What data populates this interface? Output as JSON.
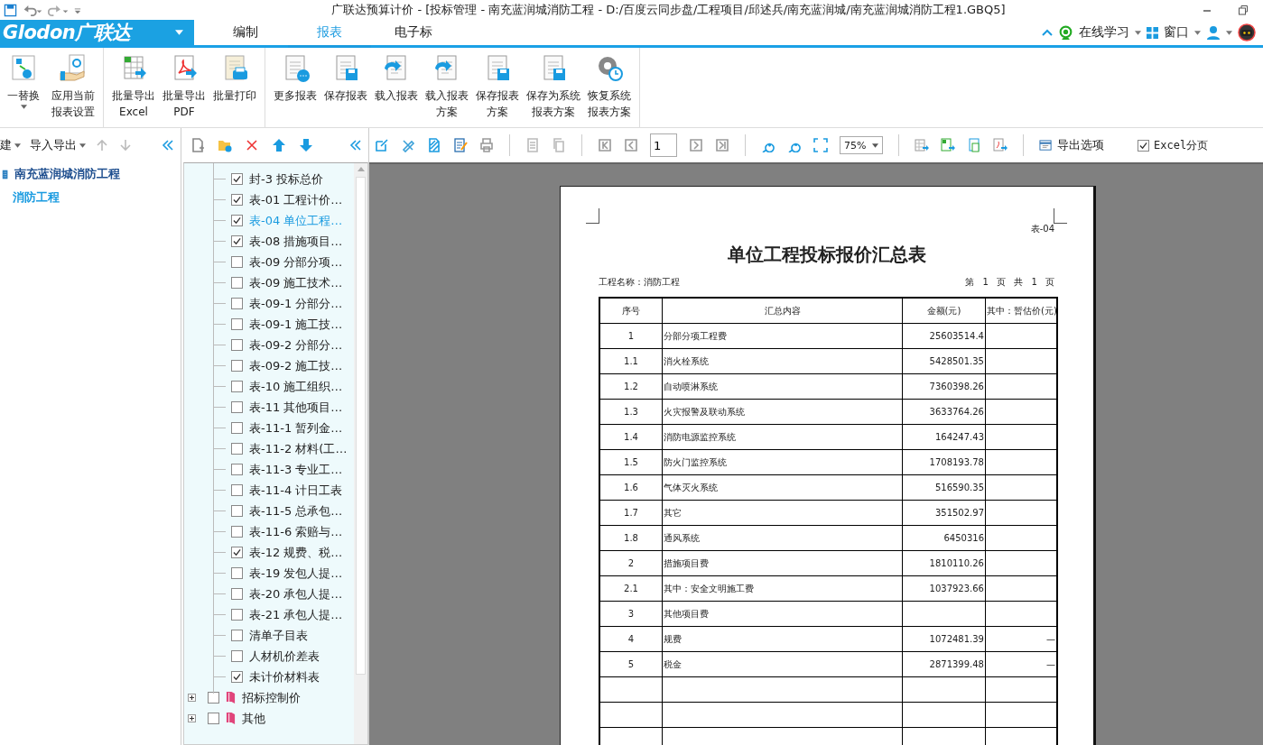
{
  "window": {
    "title": "广联达预算计价 - [投标管理 - 南充蓝润城消防工程 - D:/百度云同步盘/工程项目/邱述兵/南充蓝润城/南充蓝润城消防工程1.GBQ5]"
  },
  "logo": "Glodon广联达",
  "tabs": [
    {
      "label": "编制",
      "selected": false
    },
    {
      "label": "报表",
      "selected": true
    },
    {
      "label": "电子标",
      "selected": false
    }
  ],
  "top_right": [
    {
      "label": "在线学习"
    },
    {
      "label": "窗口"
    }
  ],
  "ribbon": [
    [
      {
        "lines": [
          "一替换"
        ],
        "dropdown": true
      },
      {
        "lines": [
          "应用当前",
          "报表设置"
        ],
        "dropdown": false
      }
    ],
    [
      {
        "lines": [
          "批量导出",
          "Excel"
        ],
        "dropdown": false
      },
      {
        "lines": [
          "批量导出",
          "PDF"
        ],
        "dropdown": false
      },
      {
        "lines": [
          "批量打印"
        ],
        "dropdown": false
      }
    ],
    [
      {
        "lines": [
          "更多报表"
        ],
        "dropdown": false
      },
      {
        "lines": [
          "保存报表"
        ],
        "dropdown": false
      },
      {
        "lines": [
          "载入报表"
        ],
        "dropdown": false
      },
      {
        "lines": [
          "载入报表",
          "方案"
        ],
        "dropdown": false
      },
      {
        "lines": [
          "保存报表",
          "方案"
        ],
        "dropdown": false
      },
      {
        "lines": [
          "保存为系统",
          "报表方案"
        ],
        "dropdown": false
      },
      {
        "lines": [
          "恢复系统",
          "报表方案"
        ],
        "dropdown": false
      }
    ]
  ],
  "left_panel": {
    "toolbar": [
      {
        "label": "建"
      },
      {
        "label": "导入导出"
      }
    ],
    "tree": [
      {
        "label": "南充蓝润城消防工程",
        "selected": false,
        "children": [
          {
            "label": "消防工程",
            "selected": true
          }
        ]
      }
    ]
  },
  "report_list": {
    "items": [
      {
        "label": "封-3 投标总价",
        "checked": true,
        "selected": false
      },
      {
        "label": "表-01 工程计价…",
        "checked": true,
        "selected": false
      },
      {
        "label": "表-04 单位工程…",
        "checked": true,
        "selected": true
      },
      {
        "label": "表-08 措施项目…",
        "checked": true,
        "selected": false
      },
      {
        "label": "表-09 分部分项…",
        "checked": false,
        "selected": false
      },
      {
        "label": "表-09 施工技术…",
        "checked": false,
        "selected": false
      },
      {
        "label": "表-09-1 分部分…",
        "checked": false,
        "selected": false
      },
      {
        "label": "表-09-1 施工技…",
        "checked": false,
        "selected": false
      },
      {
        "label": "表-09-2 分部分…",
        "checked": false,
        "selected": false
      },
      {
        "label": "表-09-2 施工技…",
        "checked": false,
        "selected": false
      },
      {
        "label": "表-10 施工组织…",
        "checked": false,
        "selected": false
      },
      {
        "label": "表-11 其他项目…",
        "checked": false,
        "selected": false
      },
      {
        "label": "表-11-1 暂列金…",
        "checked": false,
        "selected": false
      },
      {
        "label": "表-11-2 材料(工…",
        "checked": false,
        "selected": false
      },
      {
        "label": "表-11-3 专业工…",
        "checked": false,
        "selected": false
      },
      {
        "label": "表-11-4 计日工表",
        "checked": false,
        "selected": false
      },
      {
        "label": "表-11-5 总承包…",
        "checked": false,
        "selected": false
      },
      {
        "label": "表-11-6 索赔与…",
        "checked": false,
        "selected": false
      },
      {
        "label": "表-12 规费、税…",
        "checked": true,
        "selected": false
      },
      {
        "label": "表-19 发包人提…",
        "checked": false,
        "selected": false
      },
      {
        "label": "表-20 承包人提…",
        "checked": false,
        "selected": false
      },
      {
        "label": "表-21 承包人提…",
        "checked": false,
        "selected": false
      },
      {
        "label": "清单子目表",
        "checked": false,
        "selected": false
      },
      {
        "label": "人材机价差表",
        "checked": false,
        "selected": false
      },
      {
        "label": "未计价材料表",
        "checked": true,
        "selected": false
      }
    ],
    "groups": [
      {
        "label": "招标控制价",
        "checked": false,
        "expanded": false
      },
      {
        "label": "其他",
        "checked": false,
        "expanded": false
      }
    ]
  },
  "viewer_toolbar": {
    "page": "1",
    "zoom": "75%",
    "export_options": "导出选项",
    "excel_paging": {
      "label": "Excel分页",
      "checked": true
    }
  },
  "report": {
    "code": "表-04",
    "title": "单位工程投标报价汇总表",
    "project": "工程名称：消防工程",
    "page_info": "第 1 页 共 1 页",
    "columns": [
      "序号",
      "汇总内容",
      "金额(元)",
      "其中：暂估价(元)"
    ],
    "rows": [
      [
        "1",
        "分部分项工程费",
        "25603514.4",
        null
      ],
      [
        "1.1",
        "消火栓系统",
        "5428501.35",
        null
      ],
      [
        "1.2",
        "自动喷淋系统",
        "7360398.26",
        null
      ],
      [
        "1.3",
        "火灾报警及联动系统",
        "3633764.26",
        null
      ],
      [
        "1.4",
        "消防电源监控系统",
        "164247.43",
        null
      ],
      [
        "1.5",
        "防火门监控系统",
        "1708193.78",
        null
      ],
      [
        "1.6",
        "气体灭火系统",
        "516590.35",
        null
      ],
      [
        "1.7",
        "其它",
        "351502.97",
        null
      ],
      [
        "1.8",
        "通风系统",
        "6450316",
        null
      ],
      [
        "2",
        "措施项目费",
        "1810110.26",
        null
      ],
      [
        "2.1",
        "其中：安全文明施工费",
        "1037923.66",
        null
      ],
      [
        "3",
        "其他项目费",
        null,
        null
      ],
      [
        "4",
        "规费",
        "1072481.39",
        "—"
      ],
      [
        "5",
        "税金",
        "2871399.48",
        "—"
      ]
    ]
  }
}
